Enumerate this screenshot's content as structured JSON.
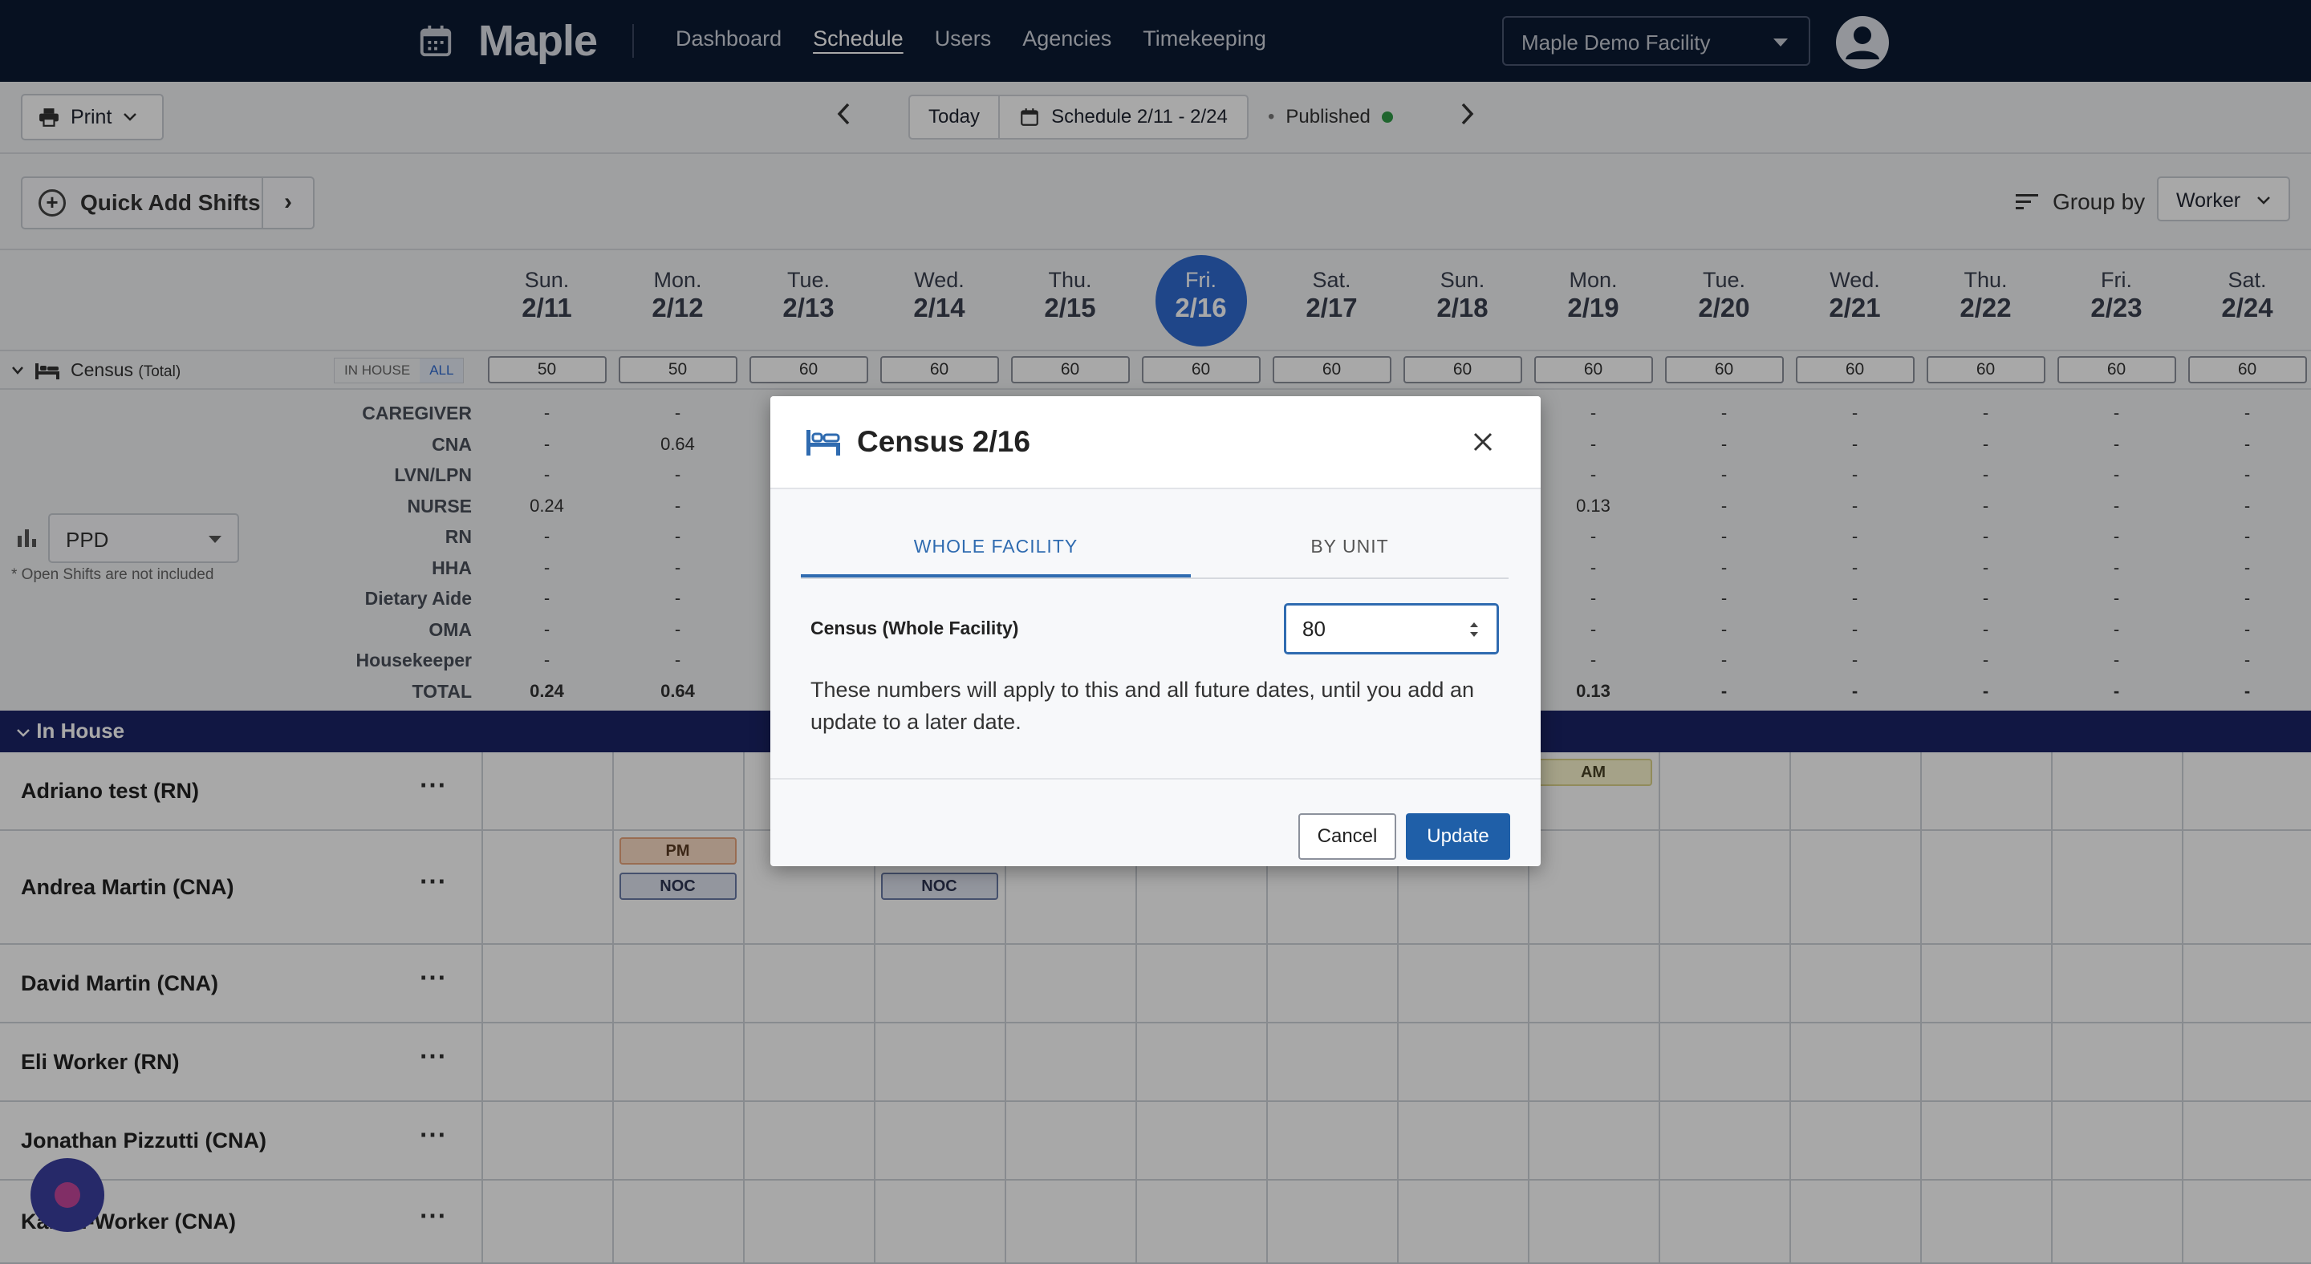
{
  "app": {
    "name": "Maple",
    "nav": [
      "Dashboard",
      "Schedule",
      "Users",
      "Agencies",
      "Timekeeping"
    ],
    "active_nav": "Schedule",
    "facility": "Maple Demo Facility"
  },
  "toolbar": {
    "print_label": "Print",
    "today_label": "Today",
    "schedule_range": "Schedule 2/11 - 2/24",
    "status_label": "Published",
    "status_color": "#2f9a47"
  },
  "quick_add": {
    "label": "Quick Add Shifts",
    "group_by_label": "Group by",
    "group_by_value": "Worker"
  },
  "days": [
    {
      "dow": "Sun.",
      "date": "2/11"
    },
    {
      "dow": "Mon.",
      "date": "2/12"
    },
    {
      "dow": "Tue.",
      "date": "2/13"
    },
    {
      "dow": "Wed.",
      "date": "2/14"
    },
    {
      "dow": "Thu.",
      "date": "2/15"
    },
    {
      "dow": "Fri.",
      "date": "2/16"
    },
    {
      "dow": "Sat.",
      "date": "2/17"
    },
    {
      "dow": "Sun.",
      "date": "2/18"
    },
    {
      "dow": "Mon.",
      "date": "2/19"
    },
    {
      "dow": "Tue.",
      "date": "2/20"
    },
    {
      "dow": "Wed.",
      "date": "2/21"
    },
    {
      "dow": "Thu.",
      "date": "2/22"
    },
    {
      "dow": "Fri.",
      "date": "2/23"
    },
    {
      "dow": "Sat.",
      "date": "2/24"
    }
  ],
  "census": {
    "label": "Census",
    "label_suffix": "(Total)",
    "toggle_in_house": "IN HOUSE",
    "toggle_all": "ALL",
    "values": [
      "50",
      "50",
      "60",
      "60",
      "60",
      "60",
      "60",
      "60",
      "60",
      "60",
      "60",
      "60",
      "60",
      "60"
    ]
  },
  "ppd": {
    "metric": "PPD",
    "note": "* Open Shifts are not included",
    "roles": [
      "CAREGIVER",
      "CNA",
      "LVN/LPN",
      "NURSE",
      "RN",
      "HHA",
      "Dietary Aide",
      "OMA",
      "Housekeeper",
      "TOTAL"
    ],
    "visible_columns": [
      0,
      1,
      8,
      9,
      10,
      11,
      12,
      13
    ],
    "rows": [
      [
        "-",
        "-",
        "-",
        "-",
        "-",
        "-",
        "-",
        "-"
      ],
      [
        "-",
        "0.64",
        "-",
        "-",
        "-",
        "-",
        "-",
        "-"
      ],
      [
        "-",
        "-",
        "-",
        "-",
        "-",
        "-",
        "-",
        "-"
      ],
      [
        "0.24",
        "-",
        "0.13",
        "-",
        "-",
        "-",
        "-",
        "-"
      ],
      [
        "-",
        "-",
        "-",
        "-",
        "-",
        "-",
        "-",
        "-"
      ],
      [
        "-",
        "-",
        "-",
        "-",
        "-",
        "-",
        "-",
        "-"
      ],
      [
        "-",
        "-",
        "-",
        "-",
        "-",
        "-",
        "-",
        "-"
      ],
      [
        "-",
        "-",
        "-",
        "-",
        "-",
        "-",
        "-",
        "-"
      ],
      [
        "-",
        "-",
        "-",
        "-",
        "-",
        "-",
        "-",
        "-"
      ],
      [
        "0.24",
        "0.64",
        "0.13",
        "-",
        "-",
        "-",
        "-",
        "-"
      ]
    ]
  },
  "section": {
    "label": "In House"
  },
  "workers": [
    {
      "name": "Adriano test (RN)"
    },
    {
      "name": "Andrea Martin (CNA)"
    },
    {
      "name": "David Martin (CNA)"
    },
    {
      "name": "Eli Worker (RN)"
    },
    {
      "name": "Jonathan Pizzutti (CNA)"
    },
    {
      "name": "Kaitlin-Worker (CNA)"
    }
  ],
  "shifts": [
    {
      "worker": 0,
      "day": 8,
      "label": "AM",
      "kind": "am",
      "slot": 0
    },
    {
      "worker": 1,
      "day": 1,
      "label": "PM",
      "kind": "pm",
      "slot": 0
    },
    {
      "worker": 1,
      "day": 1,
      "label": "NOC",
      "kind": "noc",
      "slot": 1
    },
    {
      "worker": 1,
      "day": 3,
      "label": "NOC",
      "kind": "noc",
      "slot": 1
    }
  ],
  "modal": {
    "title": "Census 2/16",
    "tab_whole": "WHOLE FACILITY",
    "tab_unit": "BY UNIT",
    "field_label": "Census (Whole Facility)",
    "field_value": "80",
    "message": "These numbers will apply to this and all future dates, until you add an update to a later date.",
    "cancel_label": "Cancel",
    "update_label": "Update"
  }
}
